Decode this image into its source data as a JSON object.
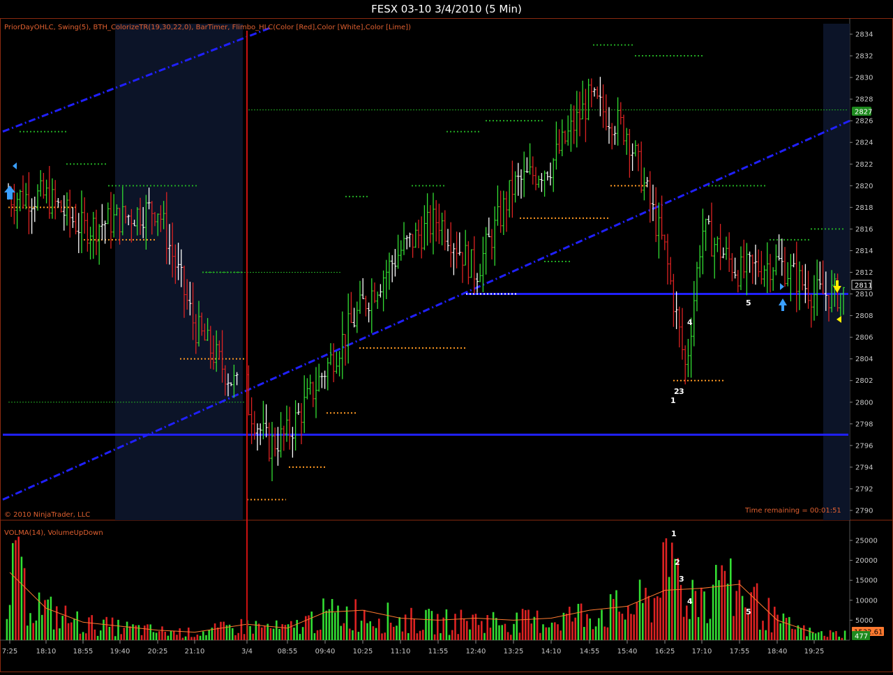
{
  "window": {
    "title": "FESX 03-10  3/4/2010 (5 Min)"
  },
  "price_panel": {
    "indicators_label": "PriorDayOHLC, Swing(5), BTH_ColorizeTR(19,30,22,0), BarTimer, Flimbo_HLC(Color [Red],Color [White],Color [Lime])",
    "copyright": "© 2010 NinjaTrader, LLC",
    "time_remaining": "Time remaining = 00:01:51",
    "current_price_box": "2811",
    "prior_close_box": "2827"
  },
  "volume_panel": {
    "indicators_label": "VOLMA(14), VolumeUpDown",
    "current_volume_box": "477",
    "volma_box": "1532.61"
  },
  "colors": {
    "up": "#33dd33",
    "down": "#dd2222",
    "neutral": "#ffffff",
    "trendline": "#2020ff",
    "session_shade": "#0c1428",
    "swing_high": "#22aa22",
    "swing_low": "#ff9922",
    "volma_line": "#ff7a30",
    "session_divider": "#cc1111"
  },
  "chart_data": [
    {
      "type": "ohlc",
      "title": "FESX 03-10  3/4/2010 (5 Min)",
      "ylim": [
        2789,
        2835
      ],
      "y_ticks": [
        2790,
        2792,
        2794,
        2796,
        2798,
        2800,
        2802,
        2804,
        2806,
        2808,
        2810,
        2812,
        2814,
        2816,
        2818,
        2820,
        2822,
        2824,
        2826,
        2828,
        2830,
        2832,
        2834
      ],
      "x_ticks": [
        "7:25",
        "18:10",
        "18:55",
        "19:40",
        "20:25",
        "21:10",
        "3/4",
        "08:55",
        "09:40",
        "10:25",
        "11:10",
        "11:55",
        "12:40",
        "13:25",
        "14:10",
        "14:55",
        "15:40",
        "16:25",
        "17:10",
        "17:55",
        "18:40",
        "19:25"
      ],
      "close_path": [
        {
          "x": "7:25",
          "y": 2819
        },
        {
          "x": "18:10",
          "y": 2819
        },
        {
          "x": "18:55",
          "y": 2816
        },
        {
          "x": "19:40",
          "y": 2817
        },
        {
          "x": "20:25",
          "y": 2818
        },
        {
          "x": "21:10",
          "y": 2807
        },
        {
          "x": "3/4",
          "y": 2800
        },
        {
          "x": "3/4",
          "y": 2796
        },
        {
          "x": "08:55",
          "y": 2797
        },
        {
          "x": "09:40",
          "y": 2803
        },
        {
          "x": "10:25",
          "y": 2809
        },
        {
          "x": "11:10",
          "y": 2814
        },
        {
          "x": "11:55",
          "y": 2817
        },
        {
          "x": "12:40",
          "y": 2812
        },
        {
          "x": "13:25",
          "y": 2820
        },
        {
          "x": "14:10",
          "y": 2822
        },
        {
          "x": "14:55",
          "y": 2828
        },
        {
          "x": "15:40",
          "y": 2825
        },
        {
          "x": "16:25",
          "y": 2814
        },
        {
          "x": "16:25",
          "y": 2803
        },
        {
          "x": "17:10",
          "y": 2816
        },
        {
          "x": "17:55",
          "y": 2812
        },
        {
          "x": "18:40",
          "y": 2813
        },
        {
          "x": "19:25",
          "y": 2810
        }
      ],
      "swing_highs": [
        2825,
        2822,
        2820,
        2812,
        2819,
        2820,
        2825,
        2833,
        2832,
        2826,
        2813,
        2820,
        2815,
        2816
      ],
      "swing_lows": [
        2818,
        2815,
        2804,
        2791,
        2794,
        2799,
        2805,
        2810,
        2817,
        2820,
        2802,
        2810
      ],
      "horizontal_levels": [
        2810,
        2797
      ],
      "swing_labels": [
        "1",
        "2",
        "3",
        "4",
        "5"
      ]
    },
    {
      "type": "bar",
      "title": "VOLMA(14), VolumeUpDown",
      "ylim": [
        0,
        27000
      ],
      "y_ticks": [
        5000,
        10000,
        15000,
        20000,
        25000
      ],
      "volma_path": [
        {
          "x": "7:25",
          "y": 17000
        },
        {
          "x": "18:10",
          "y": 8000
        },
        {
          "x": "18:55",
          "y": 4500
        },
        {
          "x": "20:25",
          "y": 2500
        },
        {
          "x": "21:10",
          "y": 2000
        },
        {
          "x": "3/4",
          "y": 4000
        },
        {
          "x": "08:55",
          "y": 3000
        },
        {
          "x": "09:40",
          "y": 7000
        },
        {
          "x": "10:25",
          "y": 7500
        },
        {
          "x": "11:10",
          "y": 5500
        },
        {
          "x": "11:55",
          "y": 5000
        },
        {
          "x": "12:40",
          "y": 5500
        },
        {
          "x": "13:25",
          "y": 5000
        },
        {
          "x": "14:10",
          "y": 5500
        },
        {
          "x": "14:55",
          "y": 7500
        },
        {
          "x": "15:40",
          "y": 8500
        },
        {
          "x": "16:25",
          "y": 12500
        },
        {
          "x": "17:10",
          "y": 13000
        },
        {
          "x": "17:55",
          "y": 14000
        },
        {
          "x": "18:40",
          "y": 5000
        },
        {
          "x": "19:25",
          "y": 1800
        }
      ],
      "labels": [
        "1",
        "2",
        "3",
        "4",
        "5"
      ]
    }
  ]
}
